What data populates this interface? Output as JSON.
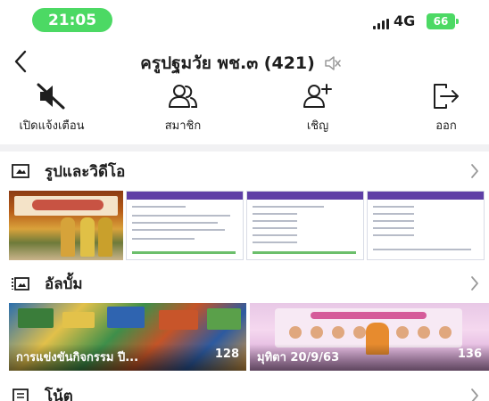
{
  "status_bar": {
    "time": "21:05",
    "network": "4G",
    "battery": "66",
    "time_pill_color": "#4cd964"
  },
  "header": {
    "title": "ครูปฐมวัย พช.๓ (421)",
    "back_icon": "chevron-left-icon",
    "muted_icon": "speaker-muted-icon"
  },
  "actions": [
    {
      "label": "เปิดแจ้งเตือน",
      "icon": "speaker-mute-icon"
    },
    {
      "label": "สมาชิก",
      "icon": "members-icon"
    },
    {
      "label": "เชิญ",
      "icon": "invite-member-icon"
    },
    {
      "label": "ออก",
      "icon": "exit-icon"
    }
  ],
  "sections": {
    "photos_videos": {
      "title": "รูปและวิดีโอ",
      "icon": "photo-icon"
    },
    "albums": {
      "title": "อัลบั้ม",
      "icon": "album-icon"
    },
    "notes": {
      "title": "โน้ต",
      "icon": "note-icon"
    }
  },
  "albums": [
    {
      "name": "การแข่งขันกิจกรรม ปี...",
      "count": "128"
    },
    {
      "name": "มุทิตา 20/9/63",
      "count": "136"
    }
  ]
}
